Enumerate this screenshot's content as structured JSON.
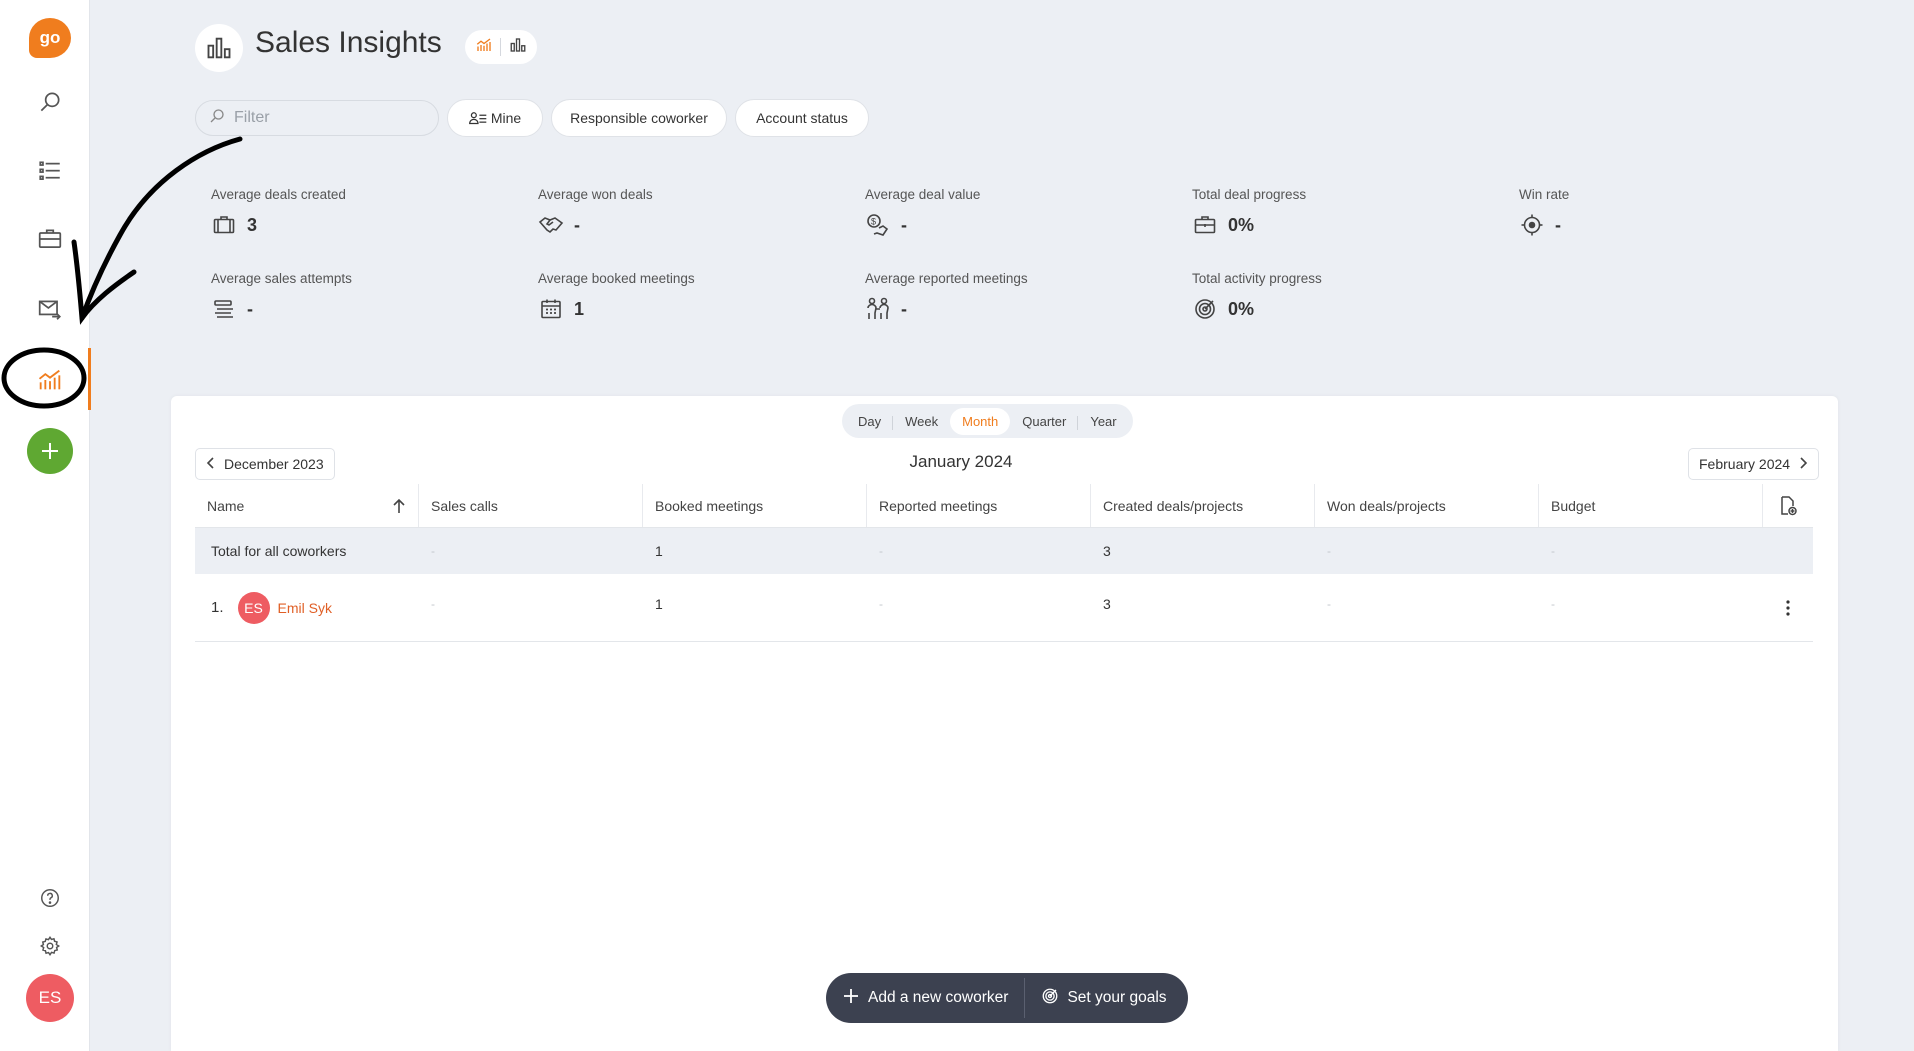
{
  "sidebar": {
    "logo_text": "go",
    "avatar_initials": "ES",
    "icons": [
      "search-icon",
      "list-icon",
      "briefcase-icon",
      "mail-forward-icon",
      "chart-icon",
      "plus-icon",
      "help-icon",
      "gear-icon"
    ]
  },
  "header": {
    "title": "Sales Insights"
  },
  "filters": {
    "placeholder": "Filter",
    "chips": {
      "mine": "Mine",
      "responsible": "Responsible coworker",
      "account_status": "Account status"
    }
  },
  "kpis": {
    "avg_deals_created": {
      "label": "Average deals created",
      "value": "3"
    },
    "avg_won_deals": {
      "label": "Average won deals",
      "value": "-"
    },
    "avg_deal_value": {
      "label": "Average deal value",
      "value": "-"
    },
    "total_deal_progress": {
      "label": "Total deal progress",
      "value": "0%"
    },
    "win_rate": {
      "label": "Win rate",
      "value": "-"
    },
    "avg_sales_attempts": {
      "label": "Average sales attempts",
      "value": "-"
    },
    "avg_booked_meetings": {
      "label": "Average booked meetings",
      "value": "1"
    },
    "avg_reported_meetings": {
      "label": "Average reported meetings",
      "value": "-"
    },
    "total_activity_progress": {
      "label": "Total activity progress",
      "value": "0%"
    }
  },
  "period": {
    "tabs": [
      "Day",
      "Week",
      "Month",
      "Quarter",
      "Year"
    ],
    "active": "Month",
    "prev": "December 2023",
    "current": "January 2024",
    "next": "February 2024"
  },
  "table": {
    "columns": [
      "Name",
      "Sales calls",
      "Booked meetings",
      "Reported meetings",
      "Created deals/projects",
      "Won deals/projects",
      "Budget"
    ],
    "total_row": {
      "label": "Total for all coworkers",
      "cells": [
        "-",
        "1",
        "-",
        "3",
        "-",
        "-"
      ]
    },
    "rows": [
      {
        "rank": "1.",
        "initials": "ES",
        "name": "Emil Syk",
        "cells": [
          "-",
          "1",
          "-",
          "3",
          "-",
          "-"
        ]
      }
    ]
  },
  "actions": {
    "add_coworker": "Add a new coworker",
    "set_goals": "Set your goals"
  },
  "colors": {
    "accent": "#f07d1e",
    "add_green": "#5fa832",
    "avatar_red": "#ee5c62",
    "action_bar": "#3c4150"
  }
}
